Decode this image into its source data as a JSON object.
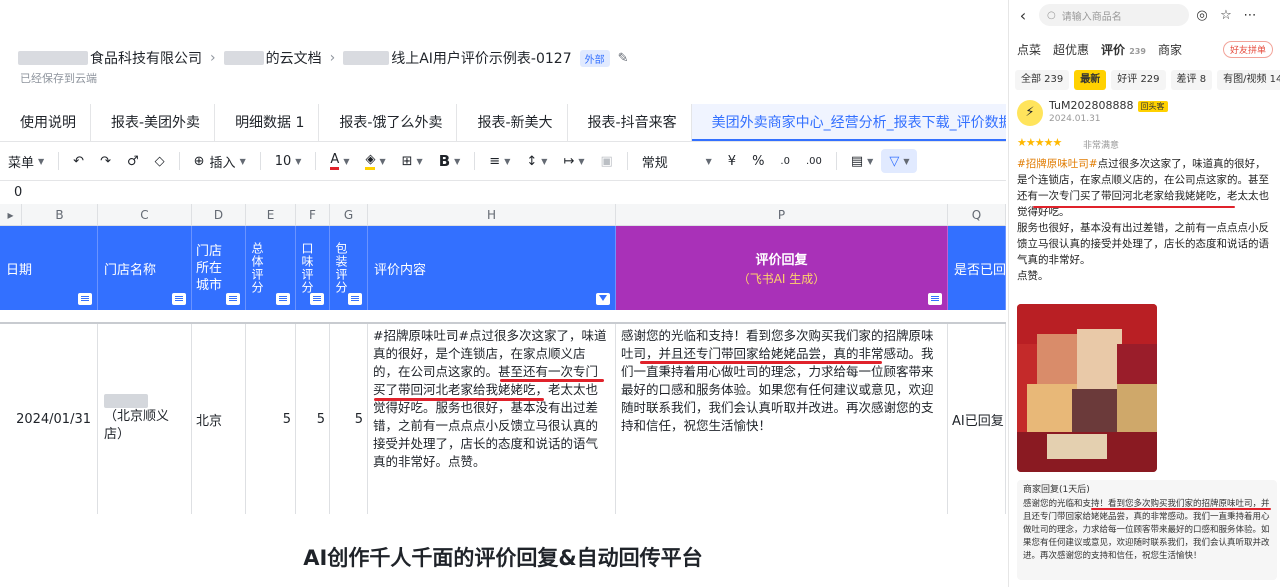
{
  "doc": {
    "breadcrumb": [
      {
        "label": "食品科技有限公司"
      },
      {
        "label": "的云文档"
      },
      {
        "label": "线上AI用户评价示例表-0127"
      }
    ],
    "badge": "外部",
    "save_status": "已经保存到云端"
  },
  "sheet_tabs": [
    "使用说明",
    "报表-美团外卖",
    "明细数据 1",
    "报表-饿了么外卖",
    "报表-新美大",
    "报表-抖音来客",
    "美团外卖商家中心_经营分析_报表下载_评价数据"
  ],
  "toolbar": {
    "menu": "菜单",
    "insert": "插入",
    "font_size": "10",
    "font_color": "A",
    "bold": "B",
    "number_format": "常规",
    "currency": "¥",
    "percent": "%"
  },
  "formula_value": "0",
  "columns": [
    "B",
    "C",
    "D",
    "E",
    "F",
    "G",
    "H",
    "P",
    "Q"
  ],
  "headers": {
    "date": "日期",
    "store": "门店名称",
    "city": "门店所在城市",
    "overall": "总体评分",
    "taste": "口味评分",
    "package": "包装评分",
    "content": "评价内容",
    "reply": "评价回复",
    "reply_sub": "（飞书AI 生成）",
    "replied": "是否已回"
  },
  "row": {
    "date": "2024/01/31",
    "store_suffix": "（北京顺义店）",
    "city": "北京",
    "overall": "5",
    "taste": "5",
    "package": "5",
    "content": "#招牌原味吐司#点过很多次这家了，味道真的很好，是个连锁店，在家点顺义店的，在公司点这家的。甚至还有一次专门买了带回河北老家给我姥姥吃，老太太也觉得好吃。服务也很好，基本没有出过差错，之前有一点点点小反馈立马很认真的接受并处理了，店长的态度和说话的语气真的非常好。点赞。",
    "reply": "感谢您的光临和支持！看到您多次购买我们家的招牌原味吐司，并且还专门带回家给姥姥品尝，真的非常感动。我们一直秉持着用心做吐司的理念，力求给每一位顾客带来最好的口感和服务体验。如果您有任何建议或意见，欢迎随时联系我们，我们会认真听取并改进。再次感谢您的支持和信任，祝您生活愉快！",
    "replied": "AI已回复"
  },
  "caption": "AI创作千人千面的评价回复&自动回传平台",
  "phone": {
    "search_placeholder": "请输入商品名",
    "tabs": [
      {
        "label": "点菜",
        "count": ""
      },
      {
        "label": "超优惠",
        "count": ""
      },
      {
        "label": "评价",
        "count": "239"
      },
      {
        "label": "商家",
        "count": ""
      }
    ],
    "friend_badge": "好友拼单",
    "chips": [
      "全部 239",
      "最新",
      "好评 229",
      "差评 8",
      "有图/视频 14"
    ],
    "review": {
      "user": "TuM202808888",
      "repeat_badge": "回头客",
      "date": "2024.01.31",
      "stars": "★★★★★",
      "rating_label": "非常满意",
      "tag": "#招牌原味吐司#",
      "text": "点过很多次这家了，味道真的很好，是个连锁店，在家点顺义店的，在公司点这家的。甚至还有一次专门买了带回河北老家给我姥姥吃，老太太也觉得好吃。",
      "text2": "服务也很好，基本没有出过差错，之前有一点点点小反馈立马很认真的接受并处理了，店长的态度和说话的语气真的非常好。",
      "text3": "点赞。"
    },
    "merchant_reply_title": "商家回复(1天后)",
    "merchant_reply": "感谢您的光临和支持！看到您多次购买我们家的招牌原味吐司，并且还专门带回家给姥姥品尝，真的非常感动。我们一直秉持着用心做吐司的理念，力求给每一位顾客带来最好的口感和服务体验。如果您有任何建议或意见，欢迎随时联系我们，我们会认真听取并改进。再次感谢您的支持和信任，祝您生活愉快！"
  },
  "colors": {
    "header_blue": "#3370ff",
    "header_purple": "#a931b8",
    "accent_yellow": "#ffd100",
    "underline_red": "#e0222b"
  }
}
